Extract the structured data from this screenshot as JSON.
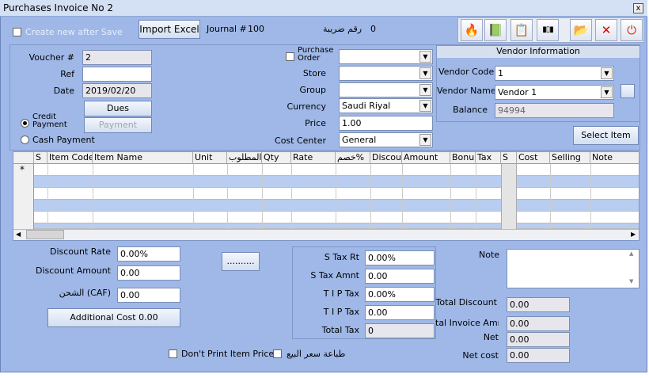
{
  "window": {
    "title": "Purchases Invoice No 2",
    "close": "x"
  },
  "top": {
    "create_new": "Create new after Save",
    "import_excel": "Import Excel",
    "journal_label": "Journal #",
    "journal_value": "100",
    "tax_no_label": "رقم ضريبة",
    "tax_no_value": "0"
  },
  "toolbar": [
    {
      "name": "fire-icon",
      "glyph": "🔥"
    },
    {
      "name": "excel-icon",
      "glyph": "📗"
    },
    {
      "name": "print-icon",
      "glyph": "📋"
    },
    {
      "name": "barcode-icon",
      "glyph": "▮▯▮"
    },
    {
      "name": "folder-icon",
      "glyph": "📂"
    },
    {
      "name": "delete-icon",
      "glyph": "✕"
    },
    {
      "name": "exit-icon",
      "glyph": "⏻"
    }
  ],
  "voucher": {
    "label": "Voucher #",
    "value": "2"
  },
  "ref": {
    "label": "Ref",
    "value": ""
  },
  "date": {
    "label": "Date",
    "value": "2019/02/20"
  },
  "dues": "Dues",
  "payment": "Payment",
  "credit_payment": "Credit Payment",
  "cash_payment": "Cash Payment",
  "purchase_order": {
    "label": "Purchase Order",
    "value": ""
  },
  "store": {
    "label": "Store",
    "value": ""
  },
  "group": {
    "label": "Group",
    "value": ""
  },
  "currency": {
    "label": "Currency",
    "value": "Saudi Riyal"
  },
  "price": {
    "label": "Price",
    "value": "1.00"
  },
  "cost_center": {
    "label": "Cost Center",
    "value": "General"
  },
  "vendor": {
    "title": "Vendor Information",
    "code_label": "Vendor Code",
    "code_value": "1",
    "name_label": "Vendor Name",
    "name_value": "Vendor 1",
    "balance_label": "Balance",
    "balance_value": "94994"
  },
  "select_item": "Select Item",
  "grid": {
    "columns": [
      "S",
      "Item Code",
      "Item Name",
      "Unit",
      "المطلوب",
      "Qty",
      "Rate",
      "خصم%",
      "Discou",
      "Amount",
      "Bonu",
      "Tax",
      "S",
      "Cost",
      "Selling",
      "Note"
    ],
    "new_row_marker": "*"
  },
  "discount_rate": {
    "label": "Discount Rate",
    "value": "0.00%"
  },
  "discount_amount": {
    "label": "Discount Amount",
    "value": "0.00"
  },
  "shipping": {
    "label": "الشحن (CAF)",
    "value": "0.00"
  },
  "additional_cost": "Additional Cost 0.00",
  "dots_button": "..........",
  "tax": {
    "s_tax_rt_label": "S Tax Rt",
    "s_tax_rt_value": "0.00%",
    "s_tax_amnt_label": "S Tax Amnt",
    "s_tax_amnt_value": "0.00",
    "tip_rate_label": "T I P Tax",
    "tip_rate_value": "0.00%",
    "tip_amnt_label": "T I P Tax",
    "tip_amnt_value": "0.00",
    "total_label": "Total Tax",
    "total_value": "0"
  },
  "note": {
    "label": "Note",
    "value": ""
  },
  "totals": {
    "total_discount_label": "Total Discount",
    "total_discount_value": "0.00",
    "invoice_amnt_label": "tal Invoice Amnt",
    "invoice_amnt_value": "0.00",
    "net_label": "Net",
    "net_value": "0.00",
    "net_cost_label": "Net cost",
    "net_cost_value": "0.00"
  },
  "dont_print_prices": "Don't Print Item Prices",
  "print_sale_price": "طباعة سعر البيع"
}
